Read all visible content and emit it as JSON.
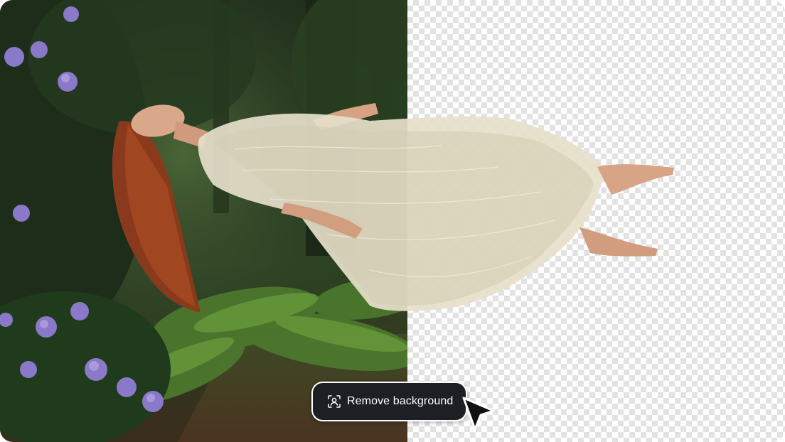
{
  "scene": {
    "left_pane": "original-photo",
    "right_pane": "transparent-cutout"
  },
  "colors": {
    "button_bg": "#1e1f24",
    "button_text": "#ffffff",
    "checker_light": "#ffffff",
    "checker_dark": "#e2e2e2",
    "cursor": "#111111"
  },
  "action": {
    "label": "Remove background",
    "icon": "person-frame-icon"
  },
  "cursor": {
    "icon": "pointer-arrow-icon"
  }
}
